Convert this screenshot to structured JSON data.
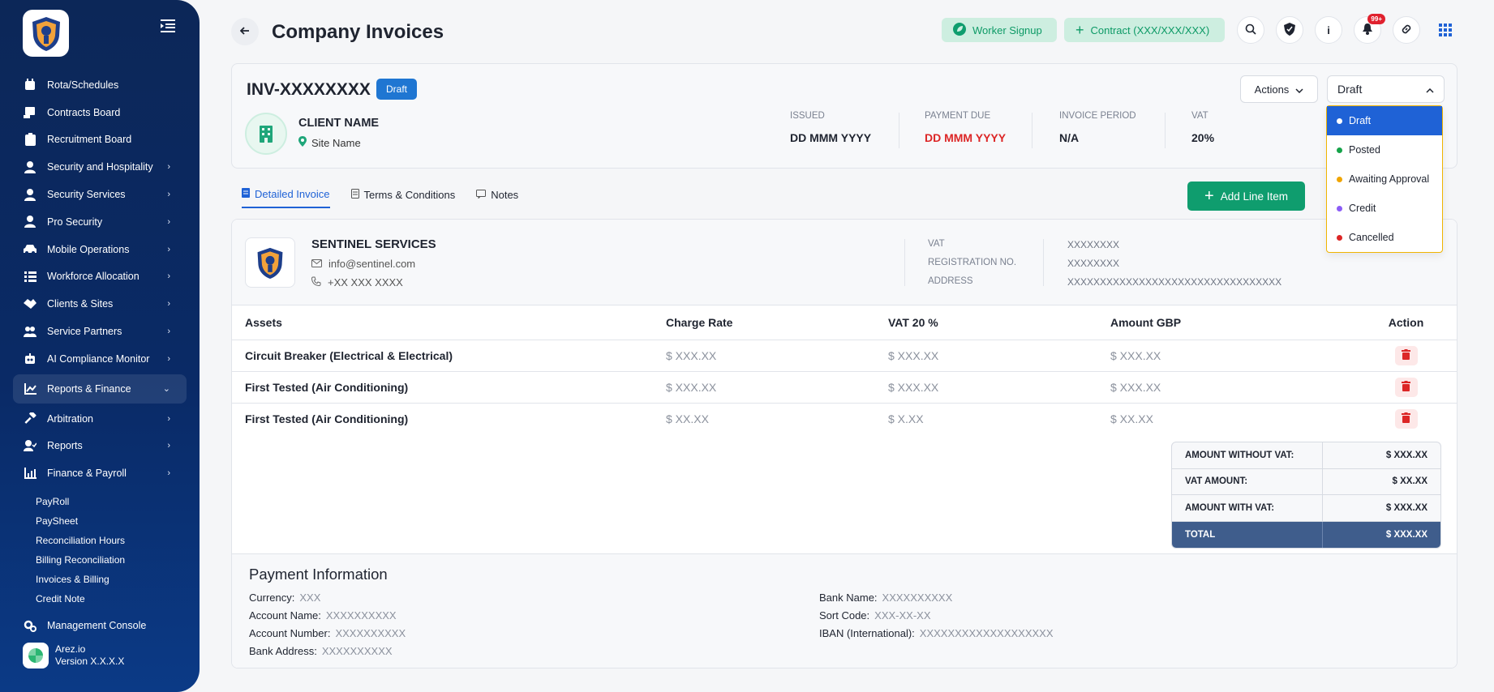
{
  "sidebar": {
    "items": [
      {
        "label": "Rota/Schedules",
        "icon": "calendar-icon",
        "chevron": false
      },
      {
        "label": "Contracts Board",
        "icon": "contract-icon",
        "chevron": false
      },
      {
        "label": "Recruitment Board",
        "icon": "clipboard-icon",
        "chevron": false
      },
      {
        "label": "Security and Hospitality",
        "icon": "user-icon",
        "chevron": true
      },
      {
        "label": "Security Services",
        "icon": "user-icon",
        "chevron": true
      },
      {
        "label": "Pro Security",
        "icon": "user-icon",
        "chevron": true
      },
      {
        "label": "Mobile Operations",
        "icon": "car-icon",
        "chevron": true
      },
      {
        "label": "Workforce Allocation",
        "icon": "list-icon",
        "chevron": true
      },
      {
        "label": "Clients & Sites",
        "icon": "handshake-icon",
        "chevron": true
      },
      {
        "label": "Service Partners",
        "icon": "partners-icon",
        "chevron": true
      },
      {
        "label": "AI Compliance Monitor",
        "icon": "robot-icon",
        "chevron": true
      },
      {
        "label": "Reports & Finance",
        "icon": "chart-icon",
        "chevron": true,
        "active": true
      },
      {
        "label": "Arbitration",
        "icon": "gavel-icon",
        "chevron": true
      },
      {
        "label": "Reports",
        "icon": "user-report-icon",
        "chevron": true
      },
      {
        "label": "Finance & Payroll",
        "icon": "bar-chart-icon",
        "chevron": true
      }
    ],
    "sub_items": [
      "PayRoll",
      "PaySheet",
      "Reconciliation Hours",
      "Billing Reconciliation",
      "Invoices & Billing",
      "Credit Note"
    ],
    "management": "Management Console",
    "brand_name": "Arez.io",
    "brand_version": "Version X.X.X.X"
  },
  "header": {
    "title": "Company Invoices",
    "worker_signup": "Worker Signup",
    "contract": "Contract (XXX/XXX/XXX)",
    "notif_badge": "99+"
  },
  "invoice": {
    "id": "INV-XXXXXXXX",
    "status_badge": "Draft",
    "client_name": "CLIENT NAME",
    "site_name": "Site Name",
    "issued_label": "ISSUED",
    "issued_value": "DD MMM YYYY",
    "due_label": "PAYMENT DUE",
    "due_value": "DD MMM YYYY",
    "period_label": "INVOICE PERIOD",
    "period_value": "N/A",
    "vat_label": "VAT",
    "vat_value": "20%",
    "actions_label": "Actions",
    "status_selected": "Draft"
  },
  "status_options": [
    {
      "label": "Draft",
      "color": "#1f62d6"
    },
    {
      "label": "Posted",
      "color": "#16a34a"
    },
    {
      "label": "Awaiting Approval",
      "color": "#f0a500"
    },
    {
      "label": "Credit",
      "color": "#8b5cf6"
    },
    {
      "label": "Cancelled",
      "color": "#dc2626"
    }
  ],
  "tabs": [
    "Detailed Invoice",
    "Terms & Conditions",
    "Notes"
  ],
  "add_line_item": "Add Line Item",
  "company": {
    "name": "SENTINEL SERVICES",
    "email": "info@sentinel.com",
    "phone": "+XX XXX XXXX",
    "vat_label": "VAT",
    "vat_value": "XXXXXXXX",
    "reg_label": "REGISTRATION NO.",
    "reg_value": "XXXXXXXX",
    "address_label": "ADDRESS",
    "address_value": "XXXXXXXXXXXXXXXXXXXXXXXXXXXXXXXXX"
  },
  "table": {
    "headers": [
      "Assets",
      "Charge Rate",
      "VAT 20 %",
      "Amount GBP",
      "Action"
    ],
    "rows": [
      [
        "Circuit Breaker (Electrical & Electrical)",
        "$ XXX.XX",
        "$ XXX.XX",
        "$ XXX.XX"
      ],
      [
        "First Tested (Air Conditioning)",
        "$ XXX.XX",
        "$ XXX.XX",
        "$ XXX.XX"
      ],
      [
        "First Tested (Air Conditioning)",
        "$ XX.XX",
        "$ X.XX",
        "$ XX.XX"
      ]
    ]
  },
  "totals": [
    {
      "label": "AMOUNT WITHOUT VAT:",
      "value": "$ XXX.XX"
    },
    {
      "label": "VAT AMOUNT:",
      "value": "$ XX.XX"
    },
    {
      "label": "AMOUNT WITH VAT:",
      "value": "$ XXX.XX"
    },
    {
      "label": "TOTAL",
      "value": "$ XXX.XX"
    }
  ],
  "payment": {
    "title": "Payment Information",
    "currency_label": "Currency:",
    "currency_value": "XXX",
    "account_name_label": "Account Name:",
    "account_name_value": "XXXXXXXXXX",
    "account_number_label": "Account Number:",
    "account_number_value": "XXXXXXXXXX",
    "bank_address_label": "Bank Address:",
    "bank_address_value": "XXXXXXXXXX",
    "bank_name_label": "Bank Name:",
    "bank_name_value": "XXXXXXXXXX",
    "sort_code_label": "Sort Code:",
    "sort_code_value": "XXX-XX-XX",
    "iban_label": "IBAN (International):",
    "iban_value": "XXXXXXXXXXXXXXXXXXX"
  },
  "colors": {
    "sidebar_bg": "#0a2a66",
    "accent_blue": "#1f62d6",
    "accent_green": "#0f9d6e",
    "danger": "#dc2626",
    "total_row": "#3f5d8c"
  }
}
